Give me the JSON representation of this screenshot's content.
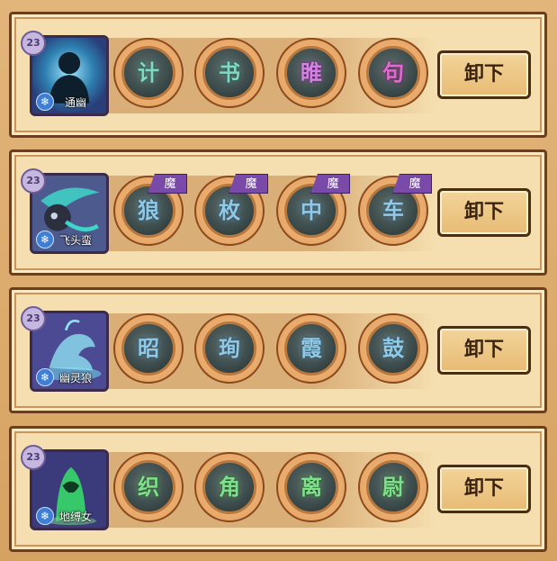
{
  "rows": [
    {
      "level": "23",
      "name": "通幽",
      "avatar_bg": "#3f8fb8",
      "avatar_icon": "dark-spirit-silhouette-icon",
      "runes": [
        {
          "glyph": "计",
          "color": "#7fd9c4",
          "mo": false
        },
        {
          "glyph": "书",
          "color": "#7fd9c4",
          "mo": false
        },
        {
          "glyph": "睢",
          "color": "#d680e6",
          "mo": false
        },
        {
          "glyph": "句",
          "color": "#e06ad0",
          "mo": false
        }
      ],
      "button_label": "卸下"
    },
    {
      "level": "23",
      "name": "飞头蛮",
      "avatar_bg": "#4f5a8c",
      "avatar_icon": "flying-head-icon",
      "mo_label": "魔",
      "runes": [
        {
          "glyph": "狼",
          "color": "#8ec9e8",
          "mo": true
        },
        {
          "glyph": "枚",
          "color": "#8ec9e8",
          "mo": true
        },
        {
          "glyph": "中",
          "color": "#8ec9e8",
          "mo": true
        },
        {
          "glyph": "车",
          "color": "#8ec9e8",
          "mo": true
        }
      ],
      "button_label": "卸下"
    },
    {
      "level": "23",
      "name": "幽灵狼",
      "avatar_bg": "#4a4a94",
      "avatar_icon": "ghost-wolf-icon",
      "runes": [
        {
          "glyph": "昭",
          "color": "#8ec9e8",
          "mo": false
        },
        {
          "glyph": "珣",
          "color": "#8ec9e8",
          "mo": false
        },
        {
          "glyph": "霞",
          "color": "#8ec9e8",
          "mo": false
        },
        {
          "glyph": "鼓",
          "color": "#8ec9e8",
          "mo": false
        }
      ],
      "button_label": "卸下"
    },
    {
      "level": "23",
      "name": "地缚女",
      "avatar_bg": "#3b3a7a",
      "avatar_icon": "green-hooded-woman-icon",
      "runes": [
        {
          "glyph": "织",
          "color": "#7ee08a",
          "mo": false
        },
        {
          "glyph": "角",
          "color": "#7ee08a",
          "mo": false
        },
        {
          "glyph": "离",
          "color": "#7ee08a",
          "mo": false
        },
        {
          "glyph": "尉",
          "color": "#7ee08a",
          "mo": false
        }
      ],
      "button_label": "卸下"
    }
  ]
}
